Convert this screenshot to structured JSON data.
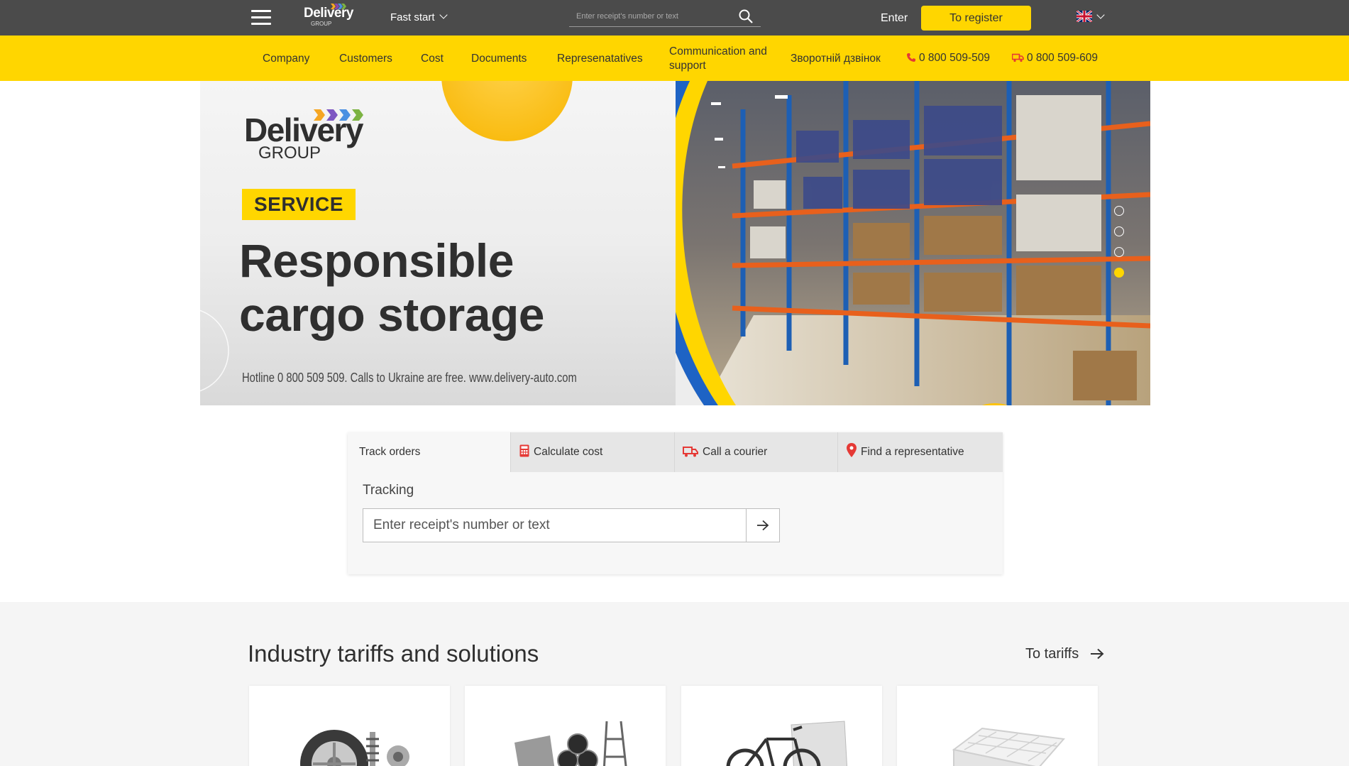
{
  "header": {
    "logo_text": "Delivery",
    "logo_sub": "GROUP",
    "fast_start": "Fast start",
    "search_placeholder": "Enter receipt's number or text",
    "enter": "Enter",
    "register": "To register",
    "language_icon": "uk-flag-icon"
  },
  "nav": {
    "items": [
      "Company",
      "Customers",
      "Cost",
      "Documents",
      "Represenatatives",
      "Communication and support",
      "Зворотній дзвінок"
    ],
    "phone1": "0 800 509-509",
    "phone2": "0 800 509-609"
  },
  "hero": {
    "logo_word": "Delivery",
    "logo_group": "GROUP",
    "badge": "SERVICE",
    "title_line1": "Responsible",
    "title_line2": "cargo storage",
    "hotline": "Hotline 0 800 509 509. Calls to Ukraine are free. www.delivery-auto.com",
    "slides": 4,
    "active_slide": 4
  },
  "widget": {
    "tabs": [
      "Track orders",
      "Calculate cost",
      "Call a courier",
      "Find a representative"
    ],
    "active_tab": "Track orders",
    "tracking_label": "Tracking",
    "tracking_placeholder": "Enter receipt's number or text"
  },
  "industry": {
    "title": "Industry tariffs and solutions",
    "to_tariffs": "To tariffs",
    "cards": [
      "auto-parts-icon",
      "metal-pipes-icon",
      "bicycle-furniture-icon",
      "mattress-icon"
    ]
  },
  "colors": {
    "brand_yellow": "#ffd600",
    "topbar": "#4b4b4b",
    "accent_red": "#e53935"
  }
}
